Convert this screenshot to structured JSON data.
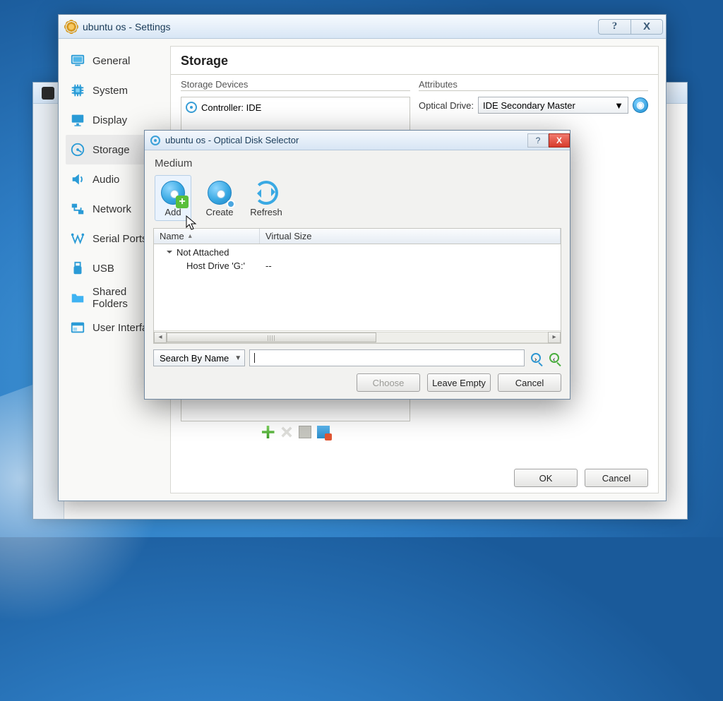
{
  "settings": {
    "title": "ubuntu os - Settings",
    "titlebar": {
      "help_symbol": "?",
      "close_symbol": "X"
    },
    "nav": [
      {
        "id": "general",
        "label": "General"
      },
      {
        "id": "system",
        "label": "System"
      },
      {
        "id": "display",
        "label": "Display"
      },
      {
        "id": "storage",
        "label": "Storage",
        "selected": true
      },
      {
        "id": "audio",
        "label": "Audio"
      },
      {
        "id": "network",
        "label": "Network"
      },
      {
        "id": "serial-ports",
        "label": "Serial Ports"
      },
      {
        "id": "usb",
        "label": "USB"
      },
      {
        "id": "shared",
        "label": "Shared Folders"
      },
      {
        "id": "ui",
        "label": "User Interface"
      }
    ],
    "storage": {
      "heading": "Storage",
      "devices_legend": "Storage Devices",
      "controller_row": "Controller: IDE",
      "attributes_legend": "Attributes",
      "optical_drive_label": "Optical Drive:",
      "optical_drive_value": "IDE Secondary Master"
    },
    "buttons": {
      "ok": "OK",
      "cancel": "Cancel"
    }
  },
  "selector": {
    "title": "ubuntu os - Optical Disk Selector",
    "titlebar": {
      "help_symbol": "?",
      "close_symbol": "X"
    },
    "heading": "Medium",
    "toolbar": {
      "add": "Add",
      "create": "Create",
      "refresh": "Refresh"
    },
    "columns": {
      "name": "Name",
      "virtual_size": "Virtual Size"
    },
    "tree": {
      "group": "Not Attached",
      "child_name": "Host Drive 'G:'",
      "child_size": "--"
    },
    "search": {
      "mode": "Search By Name",
      "value": ""
    },
    "buttons": {
      "choose": "Choose",
      "leave_empty": "Leave Empty",
      "cancel": "Cancel"
    }
  }
}
